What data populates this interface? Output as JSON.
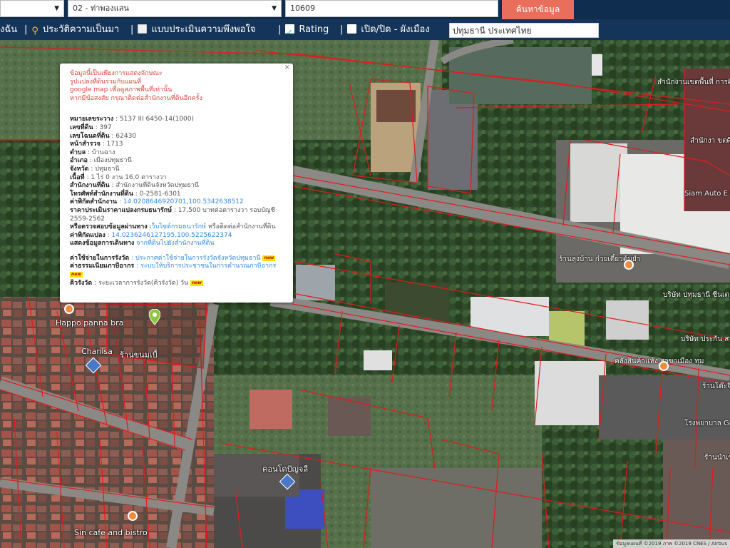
{
  "search": {
    "district_select": "02 - ท่าพองแสน",
    "parcel_input": "10609",
    "search_button": "ค้นหาข้อมูล"
  },
  "menu": {
    "item1": "งฉัน",
    "item2": "ประวัติความเป็นมา",
    "item3": "แบบประเมินความพึงพอใจ",
    "item4": "Rating",
    "item5": "เปิด/ปิด - ผังเมือง",
    "location_input": "ปทุมธานี ประเทศไทย"
  },
  "popup": {
    "notice": [
      "ข้อมูลนี้เป็นเพียงการแสดงลักษณะ",
      "รูปแปลงที่ดินร่วมกับแผนที่",
      "google map เพื่อดูสภาพพื้นที่เท่านั้น",
      "หากมีข้อสงสัย กรุณาติดต่อสำนักงานที่ดินอีกครั้ง"
    ],
    "fields": [
      {
        "label": "หมายเลขระวาง",
        "value": ": 5137 III 6450-14(1000)"
      },
      {
        "label": "เลขที่ดิน",
        "value": ": 397"
      },
      {
        "label": "เลขโฉนดที่ดิน",
        "value": ": 62430"
      },
      {
        "label": "หน้าสำรวจ",
        "value": ": 1713"
      },
      {
        "label": "ตำบล",
        "value": ": บ้านฉาง"
      },
      {
        "label": "อำเภอ",
        "value": ": เมืองปทุมธานี"
      },
      {
        "label": "จังหวัด",
        "value": ": ปทุมธานี"
      },
      {
        "label": "เนื้อที่",
        "value": ": 1 ไร่ 0 งาน 16.0 ตารางวา"
      },
      {
        "label": "สำนักงานที่ดิน",
        "value": ": สำนักงานที่ดินจังหวัดปทุมธานี"
      },
      {
        "label": "โทรศัพท์สำนักงานที่ดิน",
        "value": ": 0-2581-6301"
      },
      {
        "label": "ค่าพิกัดสำนักงาน",
        "value": ": 14.02086469207​01,100.5342638512"
      }
    ],
    "price_label": "ราคาประเมินราคาแปลงกรมธนารักษ์",
    "price_value": ": 17,500 บาทต่อตารางวา รอบบัญชี 2559-2562",
    "check_label": "หรือตรวจสอบข้อมูลผ่านทาง",
    "check_link": "เว็บไซต์กรมธนารักษ์",
    "check_suffix": "หรือติดต่อสำนักงานที่ดิน",
    "coord_label": "ค่าพิกัดแปลง",
    "coord_value": ": 14.02362461271​95,100.52256223​74",
    "route_label": "แสดงข้อมูลการเดินทาง",
    "route_link": "จากที่ดินไปยังสำนักงานที่ดิน",
    "fee_label": "ค่าใช้จ่ายในการรังวัด",
    "fee_link": ": ประกาศค่าใช้จ่ายในการรังวัดจังหวัดปทุมธานี",
    "fee2_label": "ค่าธรรมเนียมภาษีอากร",
    "fee2_link": ": ระบบให้บริการประชาชนในการคำนวณภาษีอากร",
    "survey_label": "คิวรังวัด",
    "survey_value": ": ระยะเวลาการรังวัด(คิวรังวัด) วัน",
    "new_badge": "new",
    "close": "×"
  },
  "map_labels": {
    "place1": "Happo panna bra",
    "place2": "Chanisa",
    "place3": "ร้านขนมเบื้",
    "place4": "ร้านลุงบ้าน ก๋วยเตี๋ยวต้มยำ",
    "place5": "Sin cafe and bistro",
    "place6": "คอนโดปัญจลี",
    "place7": "สำนักงานเขตพื้นที่ การศึกษาประถม",
    "place8": "สำนักงา ขตศึกษาประ",
    "place9": "Siam Auto E Car Ce",
    "place10": "บริษัท ปทุมธานี ซีนเตอร์ไพรม จำกัด",
    "place11": "บริษัท ประกัน สาขา",
    "place12": "คลังสินค้าแห้ง สาขาเมือง ทุม",
    "place13": "ร้านโต๊ะจีน",
    "place14": "โรงพยาบาล Green Anim",
    "place15": "ร้านนำเช"
  },
  "attribution": "ข้อมูลแผนที่ ©2019 ภาพ ©2019 CNES / Airbus"
}
